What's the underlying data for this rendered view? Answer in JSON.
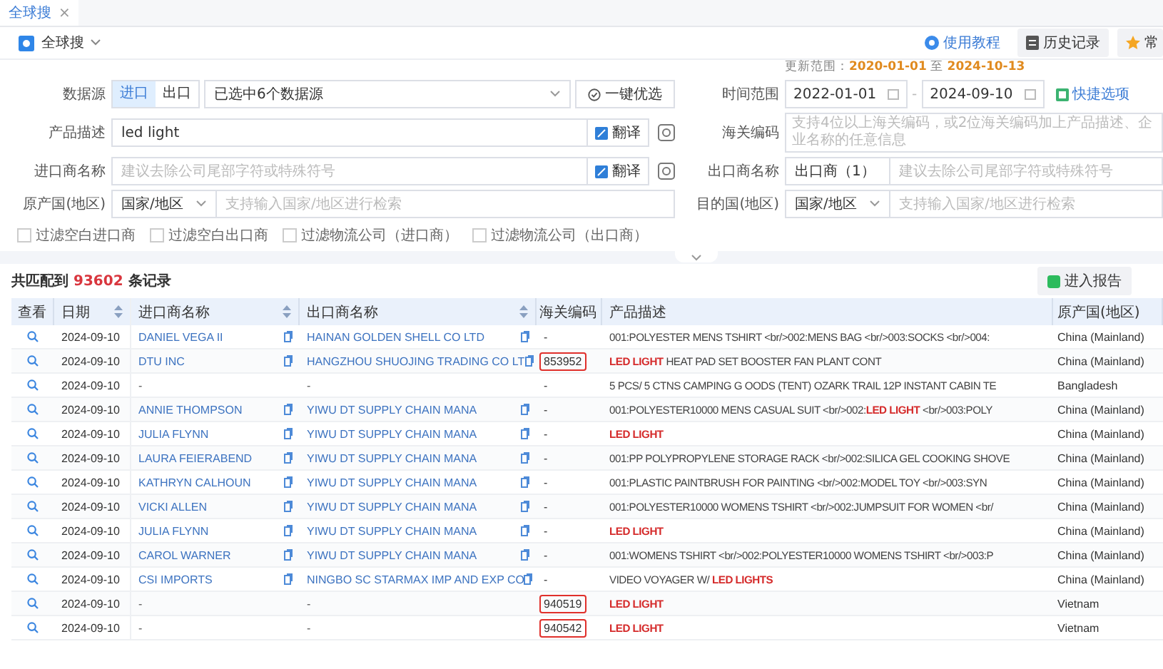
{
  "tab": {
    "label": "全球搜",
    "close": "×"
  },
  "toolbar": {
    "module": "全球搜",
    "actions": [
      {
        "kind": "help",
        "label": "使用教程"
      },
      {
        "kind": "history",
        "label": "历史记录"
      },
      {
        "kind": "favorite",
        "label": "常"
      }
    ]
  },
  "update_range": {
    "label": "更新范围：",
    "from": "2020-01-01",
    "separator": "至",
    "to": "2024-10-13"
  },
  "search_form": {
    "data_source": {
      "label": "数据源",
      "modes": [
        {
          "label": "进口",
          "selected": true
        },
        {
          "label": "出口",
          "selected": false
        }
      ],
      "select": "已选中6个数据源",
      "optimize_button": "一键优选"
    },
    "product": {
      "label": "产品描述",
      "value": "led light",
      "translate": "翻译"
    },
    "importer": {
      "label": "进口商名称",
      "placeholder": "建议去除公司尾部字符或特殊符号",
      "translate": "翻译"
    },
    "origin": {
      "label": "原产国(地区)",
      "select": "国家/地区",
      "placeholder": "支持输入国家/地区进行检索"
    },
    "time_range": {
      "label": "时间范围",
      "from": "2022-01-01",
      "separator": "-",
      "to": "2024-09-10",
      "quick": "快捷选项"
    },
    "hs_code": {
      "label": "海关编码",
      "placeholder": "支持4位以上海关编码，或2位海关编码加上产品描述、企业名称的任意信息"
    },
    "exporter": {
      "label": "出口商名称",
      "select": "出口商（1）",
      "placeholder": "建议去除公司尾部字符或特殊符号"
    },
    "destination": {
      "label": "目的国(地区)",
      "select": "国家/地区",
      "placeholder": "支持输入国家/地区进行检索"
    },
    "filters": [
      {
        "label": "过滤空白进口商",
        "checked": false
      },
      {
        "label": "过滤空白出口商",
        "checked": false
      },
      {
        "label": "过滤物流公司（进口商）",
        "checked": false
      },
      {
        "label": "过滤物流公司（出口商）",
        "checked": false
      }
    ]
  },
  "results": {
    "prefix": "共匹配到",
    "count": "93602",
    "suffix": "条记录",
    "report_button": "进入报告"
  },
  "table": {
    "columns": [
      {
        "label": "查看",
        "sortable": false
      },
      {
        "label": "日期",
        "sortable": true
      },
      {
        "label": "进口商名称",
        "sortable": true
      },
      {
        "label": "出口商名称",
        "sortable": true
      },
      {
        "label": "海关编码",
        "sortable": false
      },
      {
        "label": "产品描述",
        "sortable": false
      },
      {
        "label": "原产国(地区)",
        "sortable": false
      }
    ],
    "rows": [
      {
        "date": "2024-09-10",
        "importer": {
          "name": "DANIEL VEGA II",
          "linked": true
        },
        "exporter": {
          "name": "HAINAN GOLDEN SHELL CO LTD",
          "linked": true
        },
        "hs_code": "-",
        "hs_highlighted": false,
        "description": "001:POLYESTER MENS TSHIRT <br/>002:MENS BAG <br/>003:SOCKS <br/>004:",
        "description_emphasis": false,
        "origin": "China (Mainland)"
      },
      {
        "date": "2024-09-10",
        "importer": {
          "name": "DTU INC",
          "linked": true
        },
        "exporter": {
          "name": "HANGZHOU SHUOJING TRADING CO LT",
          "linked": true
        },
        "hs_code": "853952",
        "hs_highlighted": true,
        "description": "**LED LIGHT** HEAT PAD SET BOOSTER FAN PLANT CONT",
        "description_emphasis": false,
        "origin": "China (Mainland)"
      },
      {
        "date": "2024-09-10",
        "importer": {
          "name": "-",
          "linked": false
        },
        "exporter": {
          "name": "-",
          "linked": false
        },
        "hs_code": "-",
        "hs_highlighted": false,
        "description": "5 PCS/ 5 CTNS CAMPING G OODS (TENT) OZARK TRAIL 12P INSTANT CABIN TE",
        "description_emphasis": false,
        "origin": "Bangladesh"
      },
      {
        "date": "2024-09-10",
        "importer": {
          "name": "ANNIE THOMPSON",
          "linked": true
        },
        "exporter": {
          "name": "YIWU DT SUPPLY CHAIN MANA",
          "linked": true
        },
        "hs_code": "-",
        "hs_highlighted": false,
        "description": "001:POLYESTER10000 MENS CASUAL SUIT <br/>002:**LED LIGHT** <br/>003:POLY",
        "description_emphasis": false,
        "origin": "China (Mainland)"
      },
      {
        "date": "2024-09-10",
        "importer": {
          "name": "JULIA FLYNN",
          "linked": true
        },
        "exporter": {
          "name": "YIWU DT SUPPLY CHAIN MANA",
          "linked": true
        },
        "hs_code": "-",
        "hs_highlighted": false,
        "description": "LED LIGHT",
        "description_emphasis": true,
        "origin": "China (Mainland)"
      },
      {
        "date": "2024-09-10",
        "importer": {
          "name": "LAURA FEIERABEND",
          "linked": true
        },
        "exporter": {
          "name": "YIWU DT SUPPLY CHAIN MANA",
          "linked": true
        },
        "hs_code": "-",
        "hs_highlighted": false,
        "description": "001:PP POLYPROPYLENE STORAGE RACK <br/>002:SILICA GEL COOKING SHOVE",
        "description_emphasis": false,
        "origin": "China (Mainland)"
      },
      {
        "date": "2024-09-10",
        "importer": {
          "name": "KATHRYN CALHOUN",
          "linked": true
        },
        "exporter": {
          "name": "YIWU DT SUPPLY CHAIN MANA",
          "linked": true
        },
        "hs_code": "-",
        "hs_highlighted": false,
        "description": "001:PLASTIC PAINTBRUSH FOR PAINTING <br/>002:MODEL TOY <br/>003:SYN",
        "description_emphasis": false,
        "origin": "China (Mainland)"
      },
      {
        "date": "2024-09-10",
        "importer": {
          "name": "VICKI ALLEN",
          "linked": true
        },
        "exporter": {
          "name": "YIWU DT SUPPLY CHAIN MANA",
          "linked": true
        },
        "hs_code": "-",
        "hs_highlighted": false,
        "description": "001:POLYESTER10000 WOMENS TSHIRT <br/>002:JUMPSUIT FOR WOMEN <br/",
        "description_emphasis": false,
        "origin": "China (Mainland)"
      },
      {
        "date": "2024-09-10",
        "importer": {
          "name": "JULIA FLYNN",
          "linked": true
        },
        "exporter": {
          "name": "YIWU DT SUPPLY CHAIN MANA",
          "linked": true
        },
        "hs_code": "-",
        "hs_highlighted": false,
        "description": "LED LIGHT",
        "description_emphasis": true,
        "origin": "China (Mainland)"
      },
      {
        "date": "2024-09-10",
        "importer": {
          "name": "CAROL WARNER",
          "linked": true
        },
        "exporter": {
          "name": "YIWU DT SUPPLY CHAIN MANA",
          "linked": true
        },
        "hs_code": "-",
        "hs_highlighted": false,
        "description": "001:WOMENS TSHIRT <br/>002:POLYESTER10000 WOMENS TSHIRT <br/>003:P",
        "description_emphasis": false,
        "origin": "China (Mainland)"
      },
      {
        "date": "2024-09-10",
        "importer": {
          "name": "CSI IMPORTS",
          "linked": true
        },
        "exporter": {
          "name": "NINGBO SC STARMAX IMP AND EXP CO",
          "linked": true
        },
        "hs_code": "-",
        "hs_highlighted": false,
        "description": "VIDEO VOYAGER W/ **LED LIGHTS**",
        "description_emphasis": false,
        "origin": "China (Mainland)"
      },
      {
        "date": "2024-09-10",
        "importer": {
          "name": "-",
          "linked": false
        },
        "exporter": {
          "name": "-",
          "linked": false
        },
        "hs_code": "940519",
        "hs_highlighted": true,
        "description": "LED LIGHT",
        "description_emphasis": true,
        "origin": "Vietnam"
      },
      {
        "date": "2024-09-10",
        "importer": {
          "name": "-",
          "linked": false
        },
        "exporter": {
          "name": "-",
          "linked": false
        },
        "hs_code": "940542",
        "hs_highlighted": true,
        "description": "LED LIGHT",
        "description_emphasis": true,
        "origin": "Vietnam"
      }
    ]
  }
}
